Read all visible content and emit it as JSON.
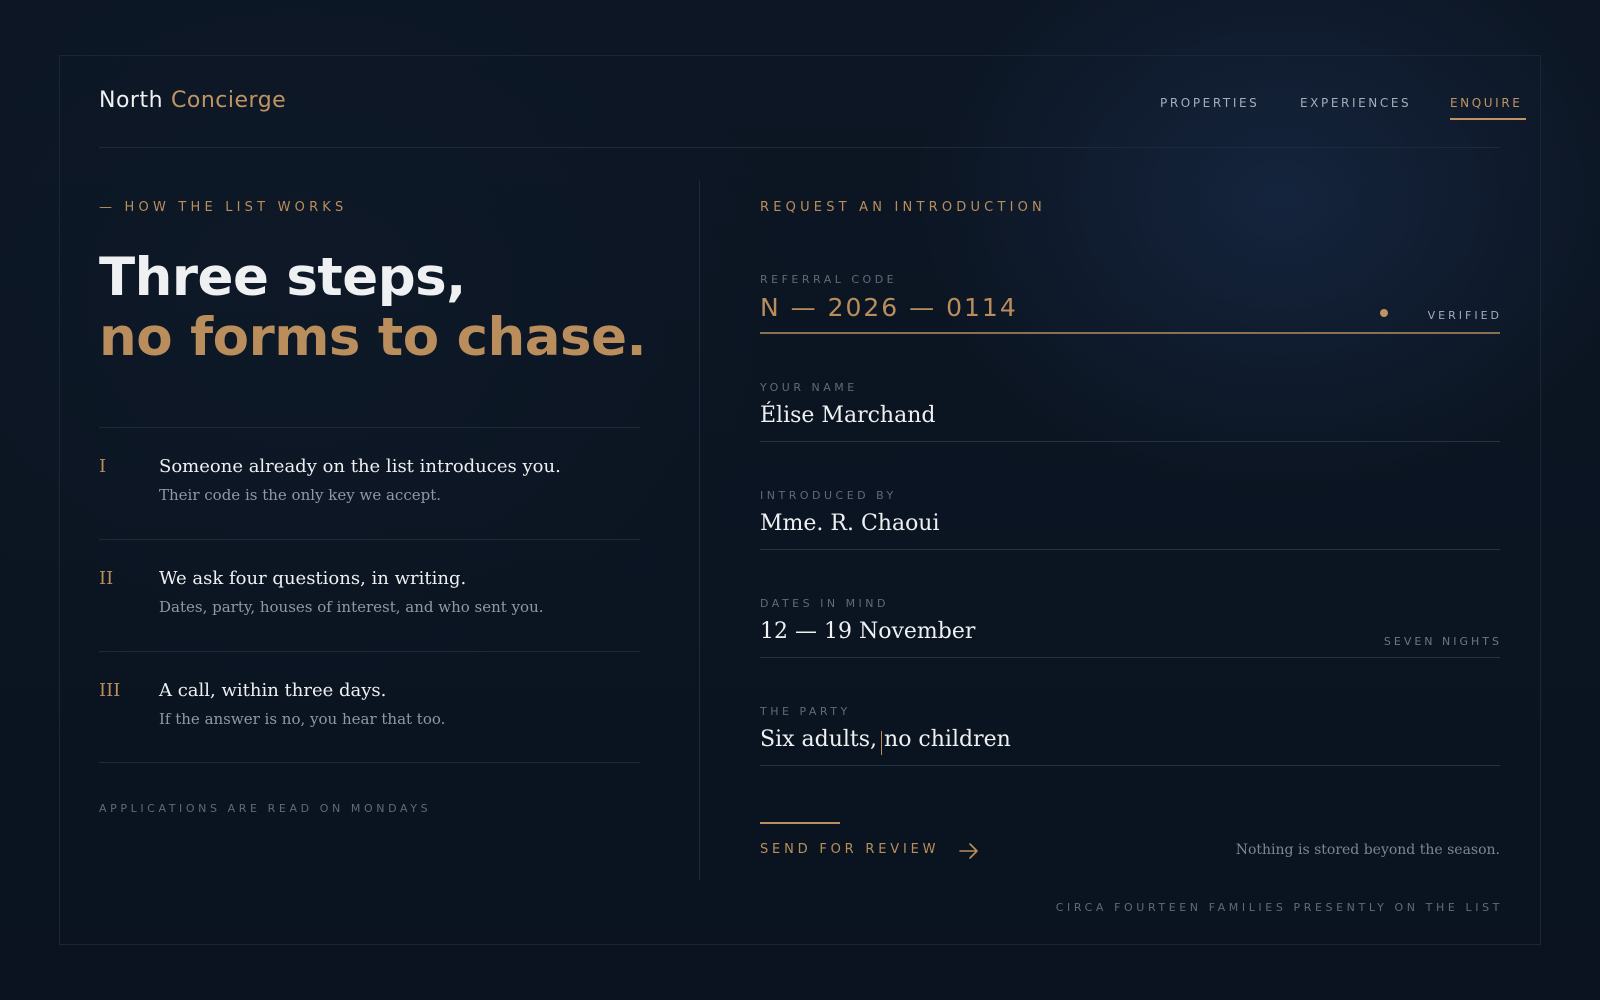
{
  "brand": {
    "name": "North",
    "accent": "Concierge"
  },
  "nav": {
    "items": [
      {
        "label": "PROPERTIES"
      },
      {
        "label": "EXPERIENCES"
      },
      {
        "label": "ENQUIRE",
        "active": true
      }
    ]
  },
  "left": {
    "eyebrow": "— HOW THE LIST WORKS",
    "headline": {
      "line1": "Three steps,",
      "line2": "no forms to chase."
    },
    "steps": [
      {
        "num": "I",
        "title": "Someone already on the list introduces you.",
        "sub": "Their code is the only key we accept."
      },
      {
        "num": "II",
        "title": "We ask four questions, in writing.",
        "sub": "Dates, party, houses of interest, and who sent you."
      },
      {
        "num": "III",
        "title": "A call, within three days.",
        "sub": "If the answer is no, you hear that too."
      }
    ],
    "footnote": "APPLICATIONS ARE READ ON MONDAYS"
  },
  "form": {
    "eyebrow": "REQUEST AN INTRODUCTION",
    "referral": {
      "label": "REFERRAL CODE",
      "value": "N — 2026 — 0114",
      "status": "VERIFIED"
    },
    "name": {
      "label": "YOUR NAME",
      "value": "Élise Marchand"
    },
    "introduced_by": {
      "label": "INTRODUCED BY",
      "value": "Mme. R. Chaoui"
    },
    "dates": {
      "label": "DATES IN MIND",
      "value": "12 — 19 November",
      "meta": "SEVEN NIGHTS"
    },
    "party": {
      "label": "THE PARTY",
      "value": "Six adults, no children"
    },
    "submit_label": "SEND FOR REVIEW",
    "note": "Nothing is stored beyond the season.",
    "footnote": "CIRCA FOURTEEN FAMILIES PRESENTLY ON THE LIST"
  },
  "colors": {
    "accent": "#bf9462",
    "background": "#0b1522",
    "text": "#eef0f2"
  },
  "icons": {
    "submit": "arrow-right-icon",
    "status": "status-dot-icon"
  }
}
